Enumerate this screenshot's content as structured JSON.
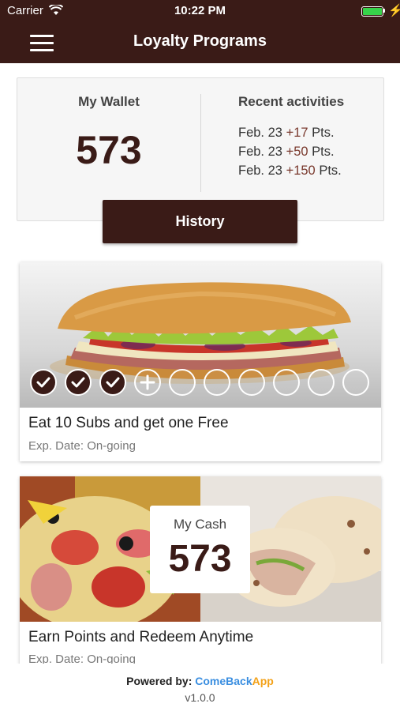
{
  "status_bar": {
    "carrier": "Carrier",
    "time": "10:22 PM",
    "battery_color": "#37d34a"
  },
  "nav": {
    "title": "Loyalty Programs",
    "menu_icon": "hamburger-menu-icon"
  },
  "wallet": {
    "label": "My Wallet",
    "points": "573",
    "activities_title": "Recent activities",
    "activities": [
      {
        "date": "Feb. 23",
        "amount": "+17",
        "unit": "Pts."
      },
      {
        "date": "Feb. 23",
        "amount": "+50",
        "unit": "Pts."
      },
      {
        "date": "Feb. 23",
        "amount": "+150",
        "unit": "Pts."
      }
    ],
    "history_button": "History"
  },
  "programs": [
    {
      "title": "Eat 10 Subs and get one Free",
      "expiration": "Exp. Date: On-going",
      "stamps_total": 10,
      "stamps_collected": 3,
      "next_stamp_icon": "plus-icon"
    },
    {
      "title": "Earn Points and Redeem Anytime",
      "expiration": "Exp. Date: On-going",
      "cash_label": "My Cash",
      "cash_points": "573"
    }
  ],
  "footer": {
    "powered_by": "Powered by:",
    "brand_part1": "ComeBack",
    "brand_part2": "App",
    "version": "v1.0.0"
  },
  "colors": {
    "primary": "#3a1b17",
    "brand_blue": "#3a8ee0",
    "brand_orange": "#f3a21a"
  }
}
